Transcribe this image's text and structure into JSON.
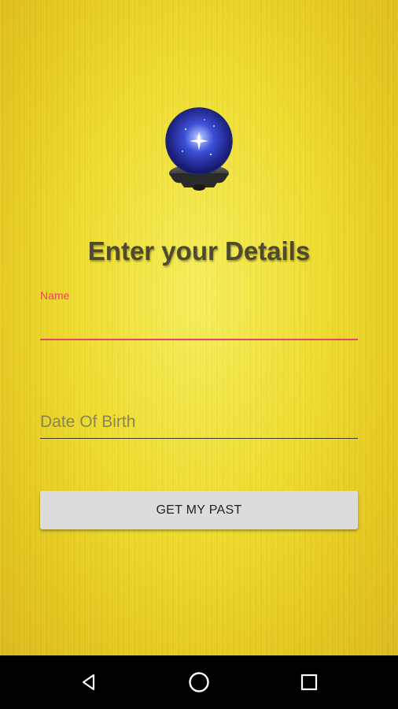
{
  "form": {
    "title": "Enter your Details",
    "name_label": "Name",
    "name_value": "",
    "dob_placeholder": "Date Of Birth",
    "submit_label": "GET MY PAST"
  },
  "icons": {
    "logo": "crystal-ball-icon",
    "nav": [
      "back-icon",
      "home-icon",
      "recents-icon"
    ]
  },
  "colors": {
    "background": "#efdc2a",
    "title": "#4d4a2e",
    "accent": "#e8416b",
    "button": "#dcdcdc",
    "navbar": "#000000"
  }
}
